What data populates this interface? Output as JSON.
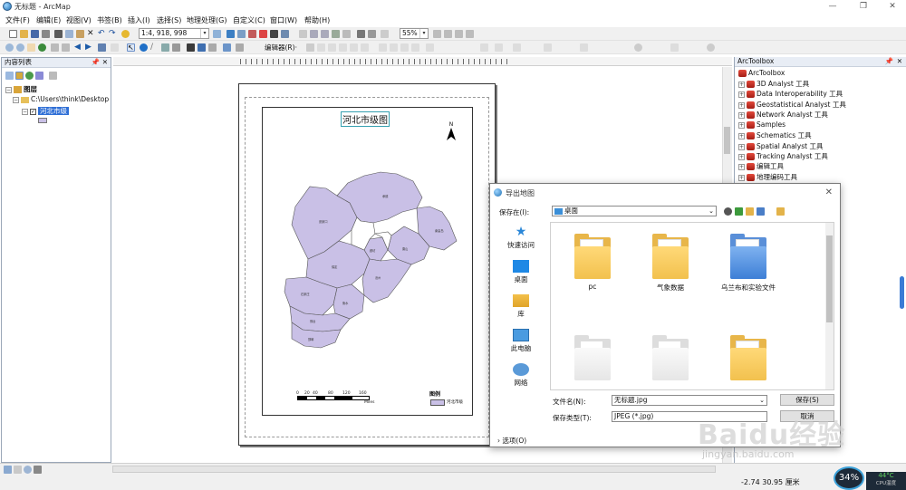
{
  "window": {
    "title": "无标题 - ArcMap"
  },
  "menu": [
    "文件(F)",
    "编辑(E)",
    "视图(V)",
    "书签(B)",
    "插入(I)",
    "选择(S)",
    "地理处理(G)",
    "自定义(C)",
    "窗口(W)",
    "帮助(H)"
  ],
  "toolbar": {
    "scale": "1:4, 918, 998",
    "zoom": "55%",
    "editor_label": "编辑器(R)·"
  },
  "toc": {
    "title": "内容列表",
    "root": "图层",
    "path": "C:\\Users\\think\\Desktop",
    "layer": "河北市级"
  },
  "layout": {
    "map_title": "河北市级图",
    "north": "N",
    "scale_ticks": [
      "0",
      "20",
      "40",
      "80",
      "120",
      "160"
    ],
    "scale_unit": "Miles",
    "legend_title": "图例",
    "legend_item": "河北市级",
    "city_labels": [
      "张家口",
      "承德",
      "秦皇岛",
      "唐山",
      "保定",
      "廊坊",
      "沧州",
      "石家庄",
      "衡水",
      "邢台",
      "邯郸"
    ]
  },
  "arctoolbox": {
    "title": "ArcToolbox",
    "root": "ArcToolbox",
    "items": [
      "3D Analyst 工具",
      "Data Interoperability 工具",
      "Geostatistical Analyst 工具",
      "Network Analyst 工具",
      "Samples",
      "Schematics 工具",
      "Spatial Analyst 工具",
      "Tracking Analyst 工具",
      "编辑工具",
      "地理编码工具"
    ]
  },
  "dialog": {
    "title": "导出地图",
    "save_in_label": "保存在(I):",
    "save_in_value": "桌面",
    "places": [
      "快速访问",
      "桌面",
      "库",
      "此电脑",
      "网络"
    ],
    "files": [
      "pc",
      "气象数据",
      "乌兰布和实验文件",
      "",
      "",
      ""
    ],
    "filename_label": "文件名(N):",
    "filename_value": "无标题.jpg",
    "filetype_label": "保存类型(T):",
    "filetype_value": "JPEG (*.jpg)",
    "save_button": "保存(S)",
    "cancel_button": "取消",
    "options": "选项(O)"
  },
  "status": {
    "coords": "-2.74  30.95 厘米",
    "cpu": "34%",
    "temp": "44°C",
    "cpu_label": "CPU温度"
  },
  "watermark": {
    "brand": "Baidu经验",
    "url": "jingyan.baidu.com"
  },
  "colors": {
    "map_fill": "#c9c0e6",
    "accent": "#1e6fd9"
  }
}
